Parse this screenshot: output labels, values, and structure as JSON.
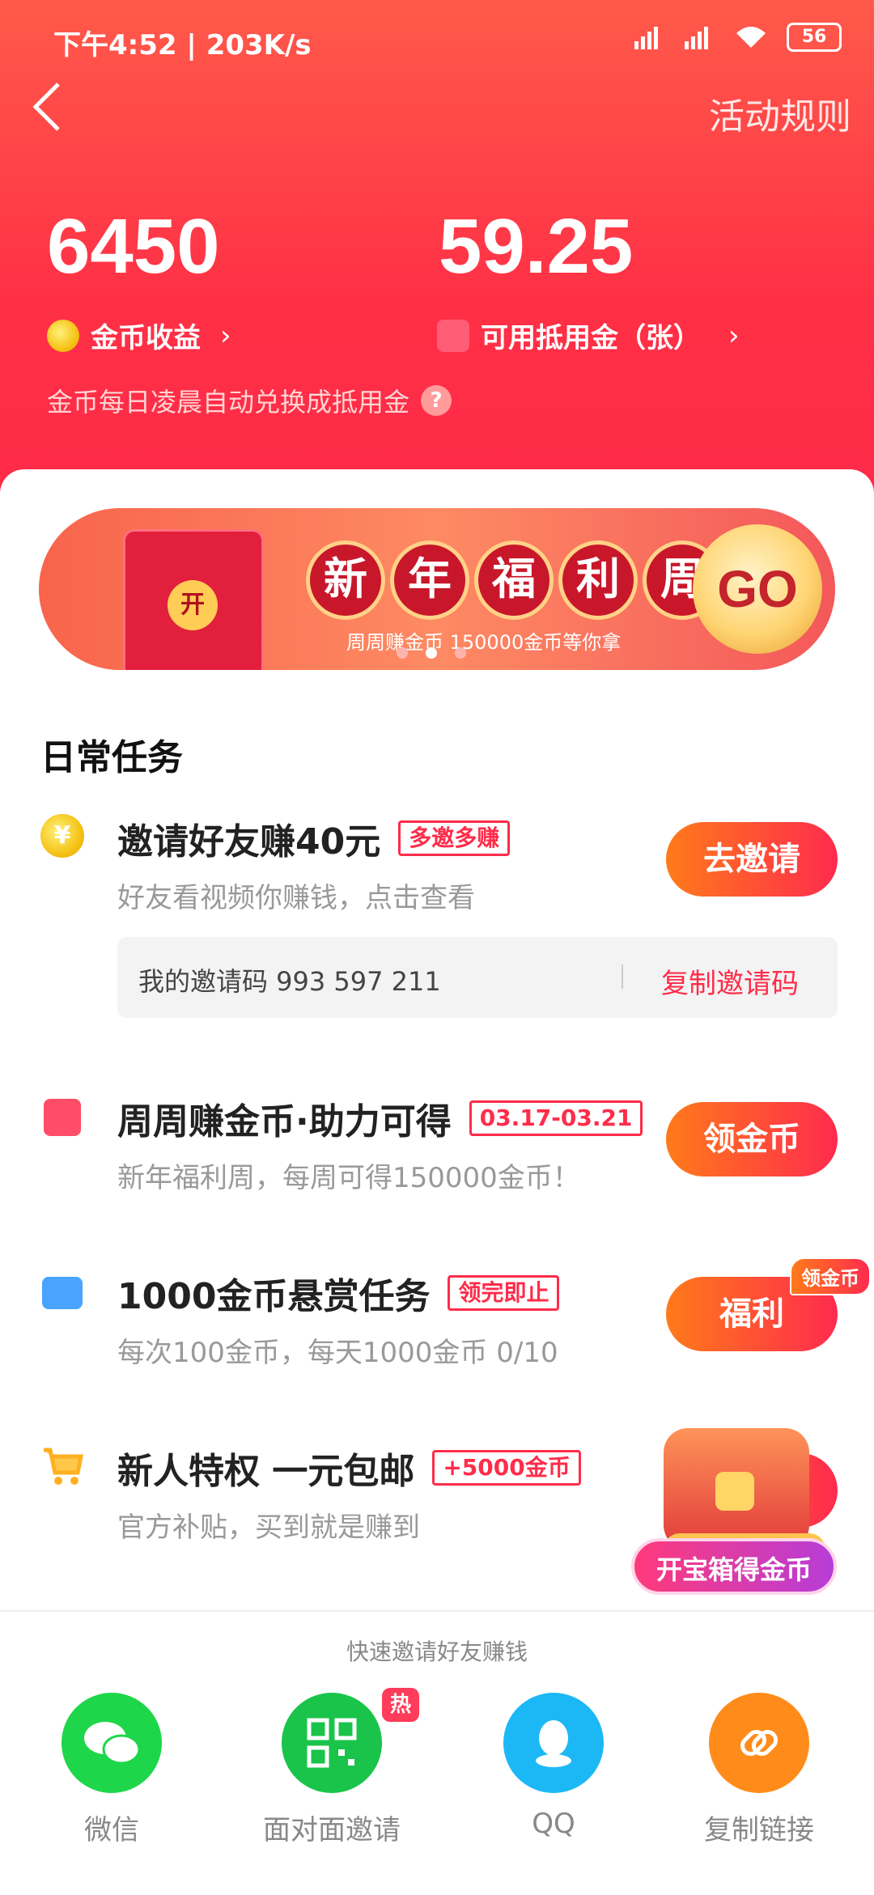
{
  "status_bar": {
    "time": "下午4:52",
    "speed": "203K/s",
    "battery": "56"
  },
  "header": {
    "rules_link": "活动规则"
  },
  "stats": {
    "coins": {
      "value": "6450",
      "label": "金币收益"
    },
    "deduction": {
      "value": "59.25",
      "label": "可用抵用金（张）"
    },
    "note": "金币每日凌晨自动兑换成抵用金"
  },
  "banner": {
    "chars": [
      "新",
      "年",
      "福",
      "利",
      "周"
    ],
    "subtitle": "周周赚金币  150000金币等你拿",
    "go": "GO",
    "seal": "开"
  },
  "daily_tasks": {
    "title": "日常任务",
    "tasks": [
      {
        "title": "邀请好友赚40元",
        "tag": "多邀多赚",
        "subtitle": "好友看视频你赚钱，点击查看",
        "button": "去邀请"
      },
      {
        "title": "周周赚金币·助力可得",
        "tag": "03.17-03.21",
        "subtitle": "新年福利周，每周可得150000金币！",
        "button": "领金币"
      },
      {
        "title": "1000金币悬赏任务",
        "tag": "领完即止",
        "subtitle": "每次100金币，每天1000金币 0/10",
        "button": "福利",
        "badge": "领金币"
      },
      {
        "title": "新人特权 一元包邮",
        "tag": "+5000金币",
        "subtitle": "官方补贴，买到就是赚到"
      }
    ],
    "invite_code": {
      "text": "我的邀请码 993 597 211",
      "copy": "复制邀请码"
    }
  },
  "treasure": {
    "label": "开宝箱得金币"
  },
  "share": {
    "title": "快速邀请好友赚钱",
    "items": [
      {
        "label": "微信"
      },
      {
        "label": "面对面邀请",
        "badge": "热"
      },
      {
        "label": "QQ"
      },
      {
        "label": "复制链接"
      }
    ]
  }
}
